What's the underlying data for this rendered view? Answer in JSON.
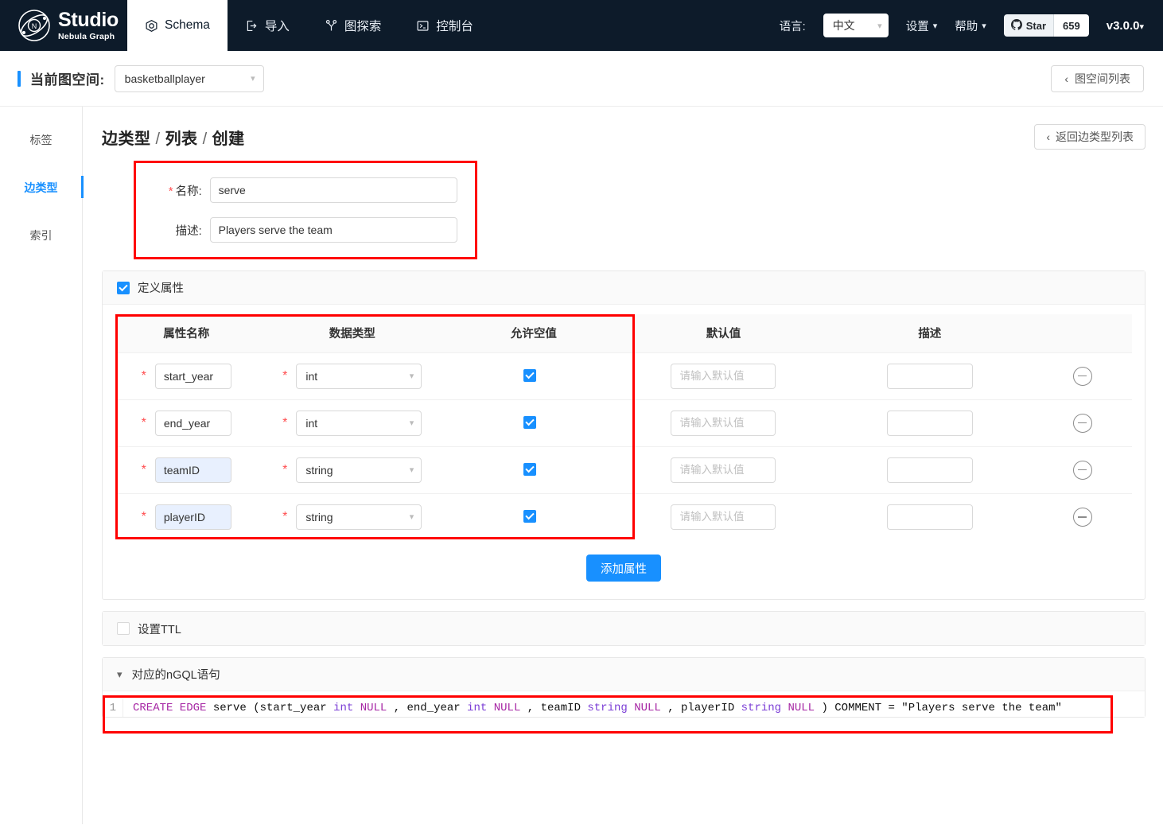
{
  "brand": {
    "title": "Studio",
    "subtitle": "Nebula Graph",
    "logo_icon": "nebula-logo-icon"
  },
  "topnav": {
    "items": [
      {
        "label": "Schema",
        "icon": "schema-icon",
        "active": true
      },
      {
        "label": "导入",
        "icon": "import-icon",
        "active": false
      },
      {
        "label": "图探索",
        "icon": "graph-explore-icon",
        "active": false
      },
      {
        "label": "控制台",
        "icon": "console-icon",
        "active": false
      }
    ],
    "lang_label": "语言:",
    "lang_value": "中文",
    "settings_label": "设置",
    "help_label": "帮助",
    "star_label": "Star",
    "star_count": "659",
    "version": "v3.0.0"
  },
  "spacebar": {
    "label": "当前图空间:",
    "space_value": "basketballplayer",
    "space_list_button": "图空间列表",
    "accent_color": "#1890ff"
  },
  "sidebar": {
    "items": [
      {
        "label": "标签",
        "active": false
      },
      {
        "label": "边类型",
        "active": true
      },
      {
        "label": "索引",
        "active": false
      }
    ]
  },
  "breadcrumb": {
    "part1": "边类型",
    "part2": "列表",
    "part3": "创建",
    "separator": "/"
  },
  "back_button": "返回边类型列表",
  "basic": {
    "name_label": "名称:",
    "name_value": "serve",
    "desc_label": "描述:",
    "desc_value": "Players serve the team"
  },
  "define_props": {
    "checkbox_label": "定义属性",
    "checked": true,
    "columns": [
      "属性名称",
      "数据类型",
      "允许空值",
      "默认值",
      "描述"
    ],
    "default_placeholder": "请输入默认值",
    "rows": [
      {
        "name": "start_year",
        "type": "int",
        "nullable": true,
        "default": "",
        "desc": "",
        "highlight_name": false
      },
      {
        "name": "end_year",
        "type": "int",
        "nullable": true,
        "default": "",
        "desc": "",
        "highlight_name": false
      },
      {
        "name": "teamID",
        "type": "string",
        "nullable": true,
        "default": "",
        "desc": "",
        "highlight_name": true
      },
      {
        "name": "playerID",
        "type": "string",
        "nullable": true,
        "default": "",
        "desc": "",
        "highlight_name": true
      }
    ],
    "add_button": "添加属性"
  },
  "ttl": {
    "checkbox_label": "设置TTL",
    "checked": false
  },
  "ngql": {
    "header": "对应的nGQL语句",
    "line_number": "1",
    "statement": "CREATE EDGE serve (start_year int NULL  , end_year int NULL  , teamID string NULL  , playerID string NULL  )  COMMENT = \"Players serve the team\"",
    "tokens": [
      {
        "t": "CREATE EDGE",
        "c": "kw"
      },
      {
        "t": " serve (start_year ",
        "c": ""
      },
      {
        "t": "int",
        "c": "ty"
      },
      {
        "t": " ",
        "c": ""
      },
      {
        "t": "NULL",
        "c": "nul"
      },
      {
        "t": "  , end_year ",
        "c": ""
      },
      {
        "t": "int",
        "c": "ty"
      },
      {
        "t": " ",
        "c": ""
      },
      {
        "t": "NULL",
        "c": "nul"
      },
      {
        "t": "  , teamID ",
        "c": ""
      },
      {
        "t": "string",
        "c": "ty"
      },
      {
        "t": " ",
        "c": ""
      },
      {
        "t": "NULL",
        "c": "nul"
      },
      {
        "t": "  , playerID ",
        "c": ""
      },
      {
        "t": "string",
        "c": "ty"
      },
      {
        "t": " ",
        "c": ""
      },
      {
        "t": "NULL",
        "c": "nul"
      },
      {
        "t": "  )  COMMENT = \"Players serve the team\"",
        "c": ""
      }
    ]
  },
  "colors": {
    "nav_bg": "#0d1b2a",
    "accent": "#1890ff",
    "highlight_red": "#ff0000",
    "required_star": "#ff4d4f",
    "keyword_purple": "#a626a4",
    "type_purple": "#7c3fd6"
  }
}
